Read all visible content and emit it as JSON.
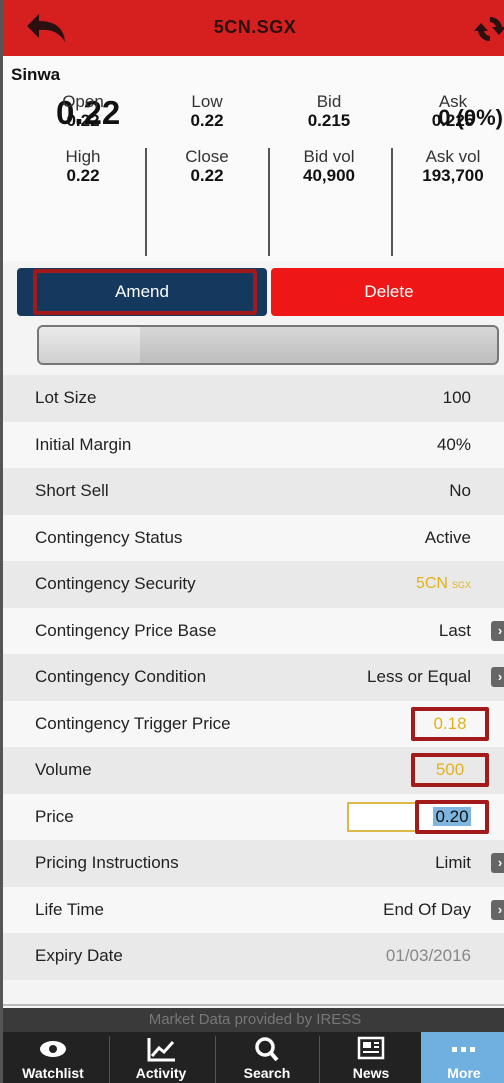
{
  "header": {
    "title": "5CN.SGX",
    "bar_color": "#d61f1f"
  },
  "quote": {
    "name": "Sinwa",
    "last": "0.22",
    "change": "0 (0%)",
    "stats": [
      {
        "label": "Open",
        "value": "0.22"
      },
      {
        "label": "Low",
        "value": "0.22"
      },
      {
        "label": "Bid",
        "value": "0.215"
      },
      {
        "label": "Ask",
        "value": "0.225"
      },
      {
        "label": "High",
        "value": "0.22"
      },
      {
        "label": "Close",
        "value": "0.22"
      },
      {
        "label": "Bid vol",
        "value": "40,900"
      },
      {
        "label": "Ask vol",
        "value": "193,700"
      }
    ]
  },
  "actions": {
    "amend_label": "Amend",
    "delete_label": "Delete",
    "amend_color": "#14385e",
    "delete_color": "#ee1616"
  },
  "progress": {
    "fraction": 0.22
  },
  "details": [
    {
      "key": "Lot Size",
      "value": "100"
    },
    {
      "key": "Initial Margin",
      "value": "40%"
    },
    {
      "key": "Short Sell",
      "value": "No"
    },
    {
      "key": "Contingency Status",
      "value": "Active"
    },
    {
      "key": "Contingency Security",
      "value": "5CN",
      "sub": "SGX"
    },
    {
      "key": "Contingency Price Base",
      "value": "Last"
    },
    {
      "key": "Contingency Condition",
      "value": "Less or Equal"
    },
    {
      "key": "Contingency Trigger Price",
      "value": "0.18"
    },
    {
      "key": "Volume",
      "value": "500"
    },
    {
      "key": "Price",
      "value": "0.20"
    },
    {
      "key": "Pricing Instructions",
      "value": "Limit"
    },
    {
      "key": "Life Time",
      "value": "End Of Day"
    },
    {
      "key": "Expiry Date",
      "value": "01/03/2016"
    }
  ],
  "footer": {
    "provider": "Market Data provided by IRESS",
    "tabs": [
      {
        "label": "Watchlist",
        "icon": "eye-icon"
      },
      {
        "label": "Activity",
        "icon": "chart-line-icon"
      },
      {
        "label": "Search",
        "icon": "search-icon"
      },
      {
        "label": "News",
        "icon": "newspaper-icon"
      },
      {
        "label": "More",
        "icon": "more-dots-icon"
      }
    ],
    "active_tab_color": "#6fb0e0"
  }
}
